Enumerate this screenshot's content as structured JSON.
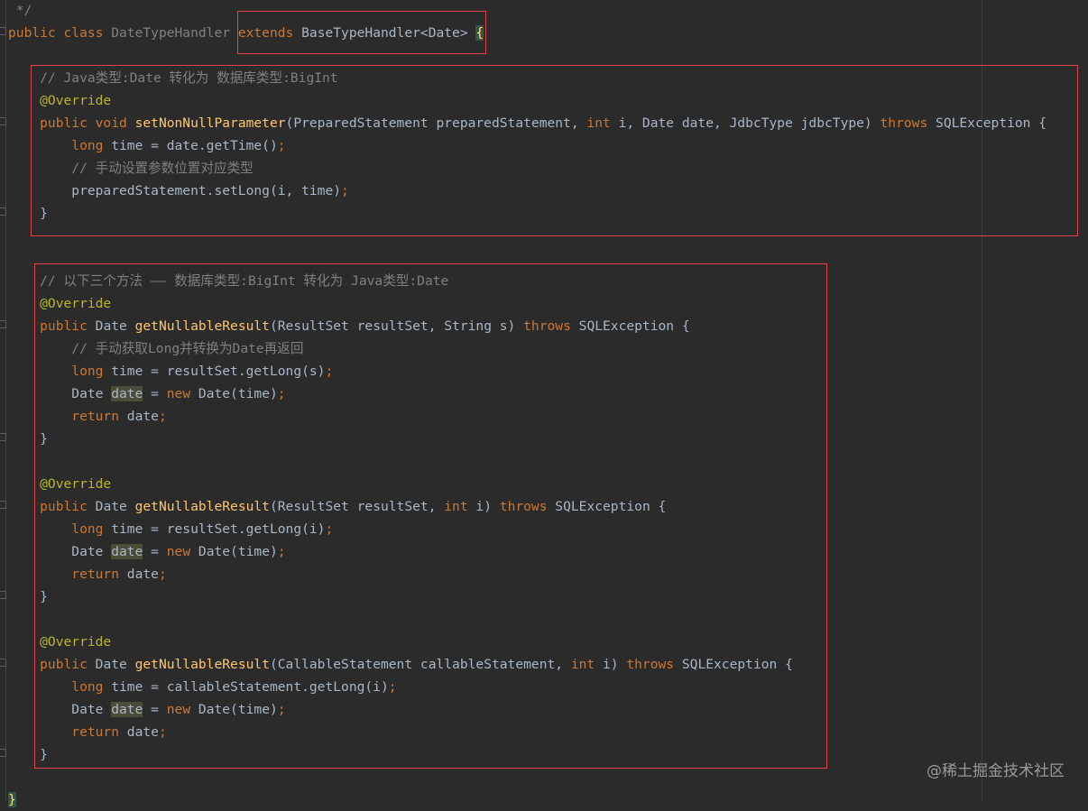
{
  "editor": {
    "lines": [
      [
        [
          "cm",
          " */"
        ]
      ],
      [
        [
          "kw",
          "public class "
        ],
        [
          "gr",
          "DateTypeHandler "
        ],
        [
          "kw",
          "extends "
        ],
        [
          "pl",
          "BaseTypeHandler<Date> "
        ],
        [
          "brace",
          "{"
        ]
      ],
      [],
      [
        [
          "cm",
          "    // Java类型:Date 转化为 数据库类型:BigInt"
        ]
      ],
      [
        [
          "an",
          "    @Override"
        ]
      ],
      [
        [
          "kw",
          "    public void "
        ],
        [
          "fn",
          "setNonNullParameter"
        ],
        [
          "pl",
          "(PreparedStatement preparedStatement, "
        ],
        [
          "kw",
          "int "
        ],
        [
          "pl",
          "i, Date date, JdbcType jdbcType) "
        ],
        [
          "kw",
          "throws "
        ],
        [
          "pl",
          "SQLException {"
        ]
      ],
      [
        [
          "kw",
          "        long "
        ],
        [
          "pl",
          "time = date.getTime()"
        ],
        [
          "kw",
          ";"
        ]
      ],
      [
        [
          "cm",
          "        // 手动设置参数位置对应类型"
        ]
      ],
      [
        [
          "pl",
          "        preparedStatement.setLong(i, time)"
        ],
        [
          "kw",
          ";"
        ]
      ],
      [
        [
          "pl",
          "    }"
        ]
      ],
      [],
      [],
      [
        [
          "cm",
          "    // 以下三个方法 —— 数据库类型:BigInt 转化为 Java类型:Date"
        ]
      ],
      [
        [
          "an",
          "    @Override"
        ]
      ],
      [
        [
          "kw",
          "    public "
        ],
        [
          "pl",
          "Date "
        ],
        [
          "fn",
          "getNullableResult"
        ],
        [
          "pl",
          "(ResultSet resultSet, String s) "
        ],
        [
          "kw",
          "throws "
        ],
        [
          "pl",
          "SQLException {"
        ]
      ],
      [
        [
          "cm",
          "        // 手动获取Long并转换为Date再返回"
        ]
      ],
      [
        [
          "kw",
          "        long "
        ],
        [
          "pl",
          "time = resultSet.getLong(s)"
        ],
        [
          "kw",
          ";"
        ]
      ],
      [
        [
          "pl",
          "        Date "
        ],
        [
          "hl",
          "date"
        ],
        [
          "pl",
          " = "
        ],
        [
          "kw",
          "new "
        ],
        [
          "pl",
          "Date(time)"
        ],
        [
          "kw",
          ";"
        ]
      ],
      [
        [
          "kw",
          "        return "
        ],
        [
          "pl",
          "date"
        ],
        [
          "kw",
          ";"
        ]
      ],
      [
        [
          "pl",
          "    }"
        ]
      ],
      [],
      [
        [
          "an",
          "    @Override"
        ]
      ],
      [
        [
          "kw",
          "    public "
        ],
        [
          "pl",
          "Date "
        ],
        [
          "fn",
          "getNullableResult"
        ],
        [
          "pl",
          "(ResultSet resultSet, "
        ],
        [
          "kw",
          "int "
        ],
        [
          "pl",
          "i) "
        ],
        [
          "kw",
          "throws "
        ],
        [
          "pl",
          "SQLException {"
        ]
      ],
      [
        [
          "kw",
          "        long "
        ],
        [
          "pl",
          "time = resultSet.getLong(i)"
        ],
        [
          "kw",
          ";"
        ]
      ],
      [
        [
          "pl",
          "        Date "
        ],
        [
          "hl",
          "date"
        ],
        [
          "pl",
          " = "
        ],
        [
          "kw",
          "new "
        ],
        [
          "pl",
          "Date(time)"
        ],
        [
          "kw",
          ";"
        ]
      ],
      [
        [
          "kw",
          "        return "
        ],
        [
          "pl",
          "date"
        ],
        [
          "kw",
          ";"
        ]
      ],
      [
        [
          "pl",
          "    }"
        ]
      ],
      [],
      [
        [
          "an",
          "    @Override"
        ]
      ],
      [
        [
          "kw",
          "    public "
        ],
        [
          "pl",
          "Date "
        ],
        [
          "fn",
          "getNullableResult"
        ],
        [
          "pl",
          "(CallableStatement callableStatement, "
        ],
        [
          "kw",
          "int "
        ],
        [
          "pl",
          "i) "
        ],
        [
          "kw",
          "throws "
        ],
        [
          "pl",
          "SQLException {"
        ]
      ],
      [
        [
          "kw",
          "        long "
        ],
        [
          "pl",
          "time = callableStatement.getLong(i)"
        ],
        [
          "kw",
          ";"
        ]
      ],
      [
        [
          "pl",
          "        Date "
        ],
        [
          "hl",
          "date"
        ],
        [
          "pl",
          " = "
        ],
        [
          "kw",
          "new "
        ],
        [
          "pl",
          "Date(time)"
        ],
        [
          "kw",
          ";"
        ]
      ],
      [
        [
          "kw",
          "        return "
        ],
        [
          "pl",
          "date"
        ],
        [
          "kw",
          ";"
        ]
      ],
      [
        [
          "pl",
          "    }"
        ]
      ],
      [],
      [
        [
          "brace",
          "}"
        ]
      ]
    ]
  },
  "watermark": "@稀土掘金技术社区",
  "colors": {
    "background": "#2b2b2b",
    "keyword": "#cc7832",
    "comment": "#808080",
    "annotation": "#bbb529",
    "method": "#ffc66d",
    "text": "#a9b7c6",
    "highlight_box": "#e0434b"
  }
}
